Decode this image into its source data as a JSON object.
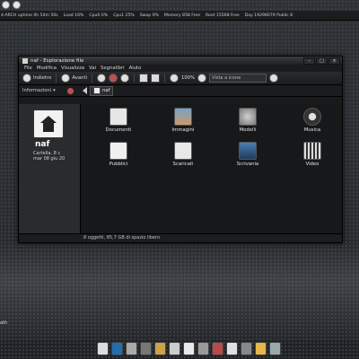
{
  "top_panel": {
    "stats": [
      "4-ARCH uptime 0h 54m 50s",
      "Load 16%",
      "Cpu0 0%",
      "Cpu1 25%",
      "Swap 0%",
      "Memory 858 Free",
      "Root 15568 Free",
      "Day 19298079 Public 8"
    ]
  },
  "window": {
    "title": "naf - Esplorazione file",
    "controls": [
      "–",
      "□",
      "×"
    ]
  },
  "menubar": [
    "File",
    "Modifica",
    "Visualizza",
    "Vai",
    "Segnalibri",
    "Aiuto"
  ],
  "toolbar": {
    "back": "Indietro",
    "forward": "Avanti",
    "zoom": "100%",
    "view_select": "Vista a icone"
  },
  "sidebar": {
    "header": "Informazioni",
    "name": "naf",
    "info_line1": "Cartella, 8 c",
    "info_line2": "mar 08 giu 20"
  },
  "location": {
    "crumb": "naf"
  },
  "files": [
    {
      "label": "Documenti",
      "icon": "documents-icon",
      "cls": "doc"
    },
    {
      "label": "Immagini",
      "icon": "images-icon",
      "cls": "img"
    },
    {
      "label": "Modelli",
      "icon": "templates-icon",
      "cls": "mod"
    },
    {
      "label": "Musica",
      "icon": "music-icon",
      "cls": "mus"
    },
    {
      "label": "Pubblici",
      "icon": "public-icon",
      "cls": "pub"
    },
    {
      "label": "Scaricati",
      "icon": "download-icon",
      "cls": "down"
    },
    {
      "label": "Scrivania",
      "icon": "desktop-icon",
      "cls": "desk"
    },
    {
      "label": "Video",
      "icon": "video-icon",
      "cls": "vid"
    }
  ],
  "status": "8 oggetti, 85,7 GB di spazio libero",
  "bottom_text": "ath",
  "colors": {
    "accent_red": "#c0504d",
    "window_bg": "#191a1c"
  }
}
